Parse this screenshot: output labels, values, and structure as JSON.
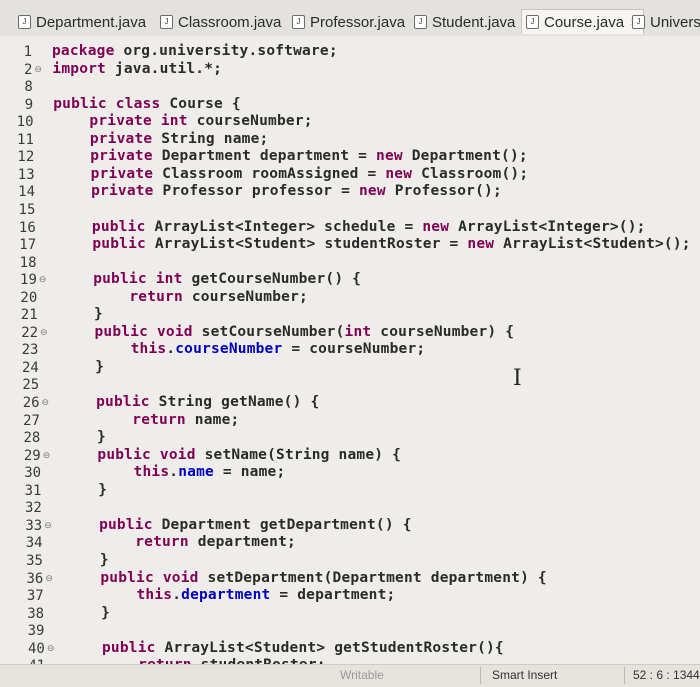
{
  "tabs": [
    {
      "label": "Department.java",
      "active": false
    },
    {
      "label": "Classroom.java",
      "active": false
    },
    {
      "label": "Professor.java",
      "active": false
    },
    {
      "label": "Student.java",
      "active": false
    },
    {
      "label": "Course.java",
      "active": true,
      "close": "✕"
    },
    {
      "label": "University",
      "active": false
    }
  ],
  "code": [
    {
      "n": "1",
      "text": "package org.university.software;"
    },
    {
      "n": "2",
      "text": "import java.util.*;"
    },
    {
      "n": "8",
      "text": ""
    },
    {
      "n": "9",
      "text": "public class Course {"
    },
    {
      "n": "10",
      "text": "    private int courseNumber;"
    },
    {
      "n": "11",
      "text": "    private String name;"
    },
    {
      "n": "12",
      "text": "    private Department department = new Department();"
    },
    {
      "n": "13",
      "text": "    private Classroom roomAssigned = new Classroom();"
    },
    {
      "n": "14",
      "text": "    private Professor professor = new Professor();"
    },
    {
      "n": "15",
      "text": ""
    },
    {
      "n": "16",
      "text": "    public ArrayList<Integer> schedule = new ArrayList<Integer>();"
    },
    {
      "n": "17",
      "text": "    public ArrayList<Student> studentRoster = new ArrayList<Student>();"
    },
    {
      "n": "18",
      "text": ""
    },
    {
      "n": "19",
      "text": "    public int getCourseNumber() {"
    },
    {
      "n": "20",
      "text": "        return courseNumber;"
    },
    {
      "n": "21",
      "text": "    }"
    },
    {
      "n": "22",
      "text": "    public void setCourseNumber(int courseNumber) {"
    },
    {
      "n": "23",
      "text": "        this.courseNumber = courseNumber;"
    },
    {
      "n": "24",
      "text": "    }"
    },
    {
      "n": "25",
      "text": ""
    },
    {
      "n": "26",
      "text": "    public String getName() {"
    },
    {
      "n": "27",
      "text": "        return name;"
    },
    {
      "n": "28",
      "text": "    }"
    },
    {
      "n": "29",
      "text": "    public void setName(String name) {"
    },
    {
      "n": "30",
      "text": "        this.name = name;"
    },
    {
      "n": "31",
      "text": "    }"
    },
    {
      "n": "32",
      "text": ""
    },
    {
      "n": "33",
      "text": "    public Department getDepartment() {"
    },
    {
      "n": "34",
      "text": "        return department;"
    },
    {
      "n": "35",
      "text": "    }"
    },
    {
      "n": "36",
      "text": "    public void setDepartment(Department department) {"
    },
    {
      "n": "37",
      "text": "        this.department = department;"
    },
    {
      "n": "38",
      "text": "    }"
    },
    {
      "n": "39",
      "text": ""
    },
    {
      "n": "40",
      "text": "    public ArrayList<Student> getStudentRoster(){"
    },
    {
      "n": "41",
      "text": "        return studentRoster;"
    }
  ],
  "folded_lines": [
    "2",
    "19",
    "22",
    "26",
    "29",
    "33",
    "36",
    "40"
  ],
  "status": {
    "writable": "Writable",
    "insert_mode": "Smart Insert",
    "position": "52 : 6 : 1344"
  }
}
